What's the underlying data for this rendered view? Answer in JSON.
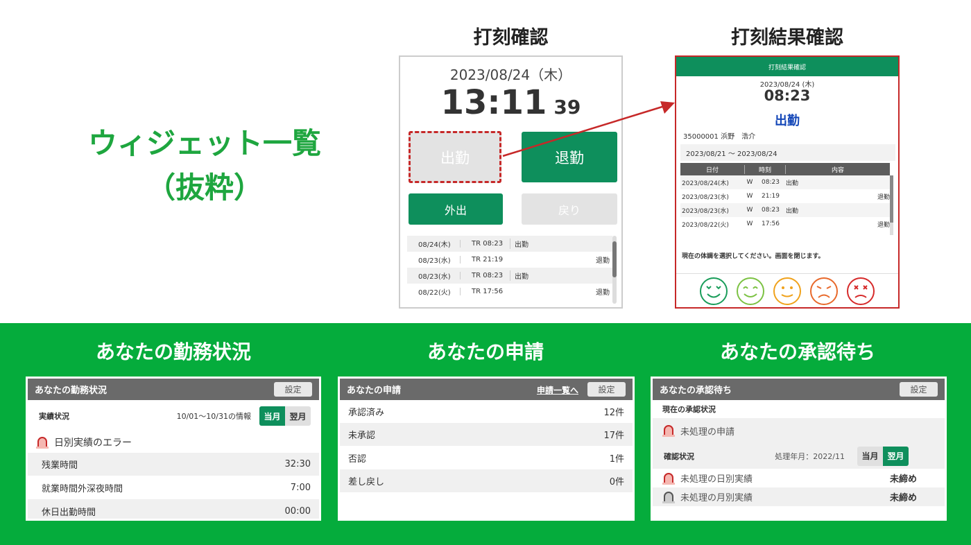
{
  "main_title": {
    "line1": "ウィジェット一覧",
    "line2": "（抜粋）"
  },
  "punch": {
    "title": "打刻確認",
    "date": "2023/08/24（木）",
    "time": "13:11",
    "seconds": "39",
    "buttons": {
      "in": "出勤",
      "out": "退勤",
      "go_out": "外出",
      "return": "戻り"
    },
    "log": [
      {
        "date": "08/24(木)",
        "time": "TR 08:23",
        "in": "出勤",
        "out": ""
      },
      {
        "date": "08/23(水)",
        "time": "TR 21:19",
        "in": "",
        "out": "退勤"
      },
      {
        "date": "08/23(水)",
        "time": "TR 08:23",
        "in": "出勤",
        "out": ""
      },
      {
        "date": "08/22(火)",
        "time": "TR 17:56",
        "in": "",
        "out": "退勤"
      }
    ]
  },
  "result": {
    "title": "打刻結果確認",
    "header": "打刻結果確認",
    "date": "2023/08/24 (木)",
    "time": "08:23",
    "kind": "出勤",
    "user": "35000001 浜野　浩介",
    "range": "2023/08/21 ～ 2023/08/24",
    "columns": [
      "日付",
      "時刻",
      "内容"
    ],
    "rows": [
      {
        "date": "2023/08/24(木)",
        "w": "W",
        "time": "08:23",
        "in": "出勤",
        "out": ""
      },
      {
        "date": "2023/08/23(水)",
        "w": "W",
        "time": "21:19",
        "in": "",
        "out": "退勤"
      },
      {
        "date": "2023/08/23(水)",
        "w": "W",
        "time": "08:23",
        "in": "出勤",
        "out": ""
      },
      {
        "date": "2023/08/22(火)",
        "w": "W",
        "time": "17:56",
        "in": "",
        "out": "退勤"
      }
    ],
    "message": "現在の体調を選択してください。画面を閉じます。",
    "faces": [
      {
        "icon": "very-happy-face-icon",
        "color": "#1a9d5a"
      },
      {
        "icon": "happy-face-icon",
        "color": "#7cc243"
      },
      {
        "icon": "neutral-face-icon",
        "color": "#f0a21c"
      },
      {
        "icon": "sad-face-icon",
        "color": "#e8692b"
      },
      {
        "icon": "very-sad-face-icon",
        "color": "#d62a2a"
      }
    ]
  },
  "work": {
    "section_title": "あなたの勤務状況",
    "header": "あなたの勤務状況",
    "settings": "設定",
    "status_label": "実績状況",
    "period": "10/01～10/31の情報",
    "toggle": {
      "current": "当月",
      "next": "翌月"
    },
    "error": "日別実績のエラー",
    "items": [
      {
        "label": "残業時間",
        "value": "32:30"
      },
      {
        "label": "就業時間外深夜時間",
        "value": "7:00"
      },
      {
        "label": "休日出勤時間",
        "value": "00:00"
      }
    ]
  },
  "apply": {
    "section_title": "あなたの申請",
    "header": "あなたの申請",
    "list_link": "申請一覧へ",
    "settings": "設定",
    "items": [
      {
        "label": "承認済み",
        "value": "12件"
      },
      {
        "label": "未承認",
        "value": "17件"
      },
      {
        "label": "否認",
        "value": "1件"
      },
      {
        "label": "差し戻し",
        "value": "0件"
      }
    ]
  },
  "approval": {
    "section_title": "あなたの承認待ち",
    "header": "あなたの承認待ち",
    "settings": "設定",
    "current_label": "現在の承認状況",
    "pending_apply": "未処理の申請",
    "confirm_label": "確認状況",
    "process_month": "処理年月：2022/11",
    "toggle": {
      "current": "当月",
      "next": "翌月"
    },
    "items": [
      {
        "label": "未処理の日別実績",
        "value": "未締め"
      },
      {
        "label": "未処理の月別実績",
        "value": "未締め"
      }
    ]
  },
  "colors": {
    "brand_green": "#05ac3c",
    "button_green": "#0e8f5c",
    "alert_red": "#c62828",
    "header_gray": "#6a6a6a"
  }
}
